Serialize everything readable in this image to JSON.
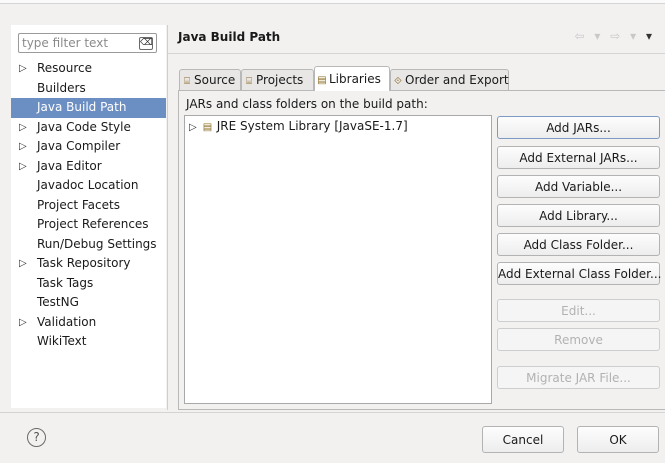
{
  "filter": {
    "placeholder": "type filter text",
    "clear_glyph": "⌫"
  },
  "tree": [
    {
      "label": "Resource",
      "arrow": "▷"
    },
    {
      "label": "Builders",
      "arrow": ""
    },
    {
      "label": "Java Build Path",
      "arrow": "",
      "selected": true
    },
    {
      "label": "Java Code Style",
      "arrow": "▷"
    },
    {
      "label": "Java Compiler",
      "arrow": "▷"
    },
    {
      "label": "Java Editor",
      "arrow": "▷"
    },
    {
      "label": "Javadoc Location",
      "arrow": ""
    },
    {
      "label": "Project Facets",
      "arrow": ""
    },
    {
      "label": "Project References",
      "arrow": ""
    },
    {
      "label": "Run/Debug Settings",
      "arrow": ""
    },
    {
      "label": "Task Repository",
      "arrow": "▷"
    },
    {
      "label": "Task Tags",
      "arrow": ""
    },
    {
      "label": "TestNG",
      "arrow": ""
    },
    {
      "label": "Validation",
      "arrow": "▷"
    },
    {
      "label": "WikiText",
      "arrow": ""
    }
  ],
  "page": {
    "title": "Java Build Path",
    "nav_back": "⇦",
    "nav_forward": "⇨",
    "nav_menu": "▾"
  },
  "tabs": [
    {
      "label": "Source",
      "icon": "⌸",
      "icon_name": "source-folder-icon"
    },
    {
      "label": "Projects",
      "icon": "⌸",
      "icon_name": "project-icon"
    },
    {
      "label": "Libraries",
      "icon": "▤",
      "icon_name": "library-icon",
      "active": true
    },
    {
      "label": "Order and Export",
      "icon": "⟐",
      "icon_name": "order-export-icon"
    }
  ],
  "libraries": {
    "caption": "JARs and class folders on the build path:",
    "items": [
      {
        "label": "JRE System Library [JavaSE-1.7]",
        "arrow": "▷"
      }
    ]
  },
  "buttons": {
    "add_jars": "Add JARs...",
    "add_external_jars": "Add External JARs...",
    "add_variable": "Add Variable...",
    "add_library": "Add Library...",
    "add_class_folder": "Add Class Folder...",
    "add_external_class_folder": "Add External Class Folder...",
    "edit": "Edit...",
    "remove": "Remove",
    "migrate_jar": "Migrate JAR File..."
  },
  "footer": {
    "help": "?",
    "cancel": "Cancel",
    "ok": "OK"
  }
}
